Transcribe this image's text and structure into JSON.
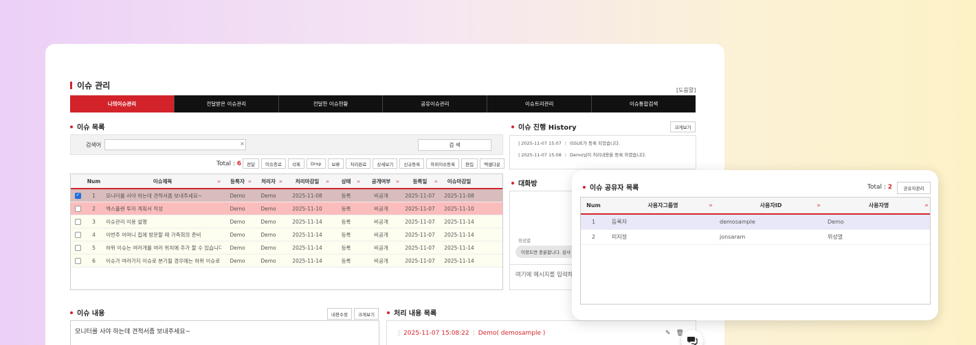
{
  "page": {
    "title": "이슈 관리",
    "help": "[도움말]"
  },
  "tabs": [
    {
      "label": "나의이슈관리",
      "active": true
    },
    {
      "label": "전달받은 이슈관리"
    },
    {
      "label": "전달한 이슈현황"
    },
    {
      "label": "공유이슈관리"
    },
    {
      "label": "이슈트리관리"
    },
    {
      "label": "이슈통합검색"
    }
  ],
  "issue_list": {
    "title": "이슈 목록",
    "search_label": "검색어",
    "search_value": "",
    "search_button": "검 색",
    "total_label": "Total : ",
    "total_count": "6",
    "buttons": [
      "전달",
      "이슈종료",
      "삭제",
      "Drop",
      "보류",
      "처리완료",
      "상세보기",
      "신규등록",
      "하위이슈등록",
      "편집",
      "엑셀다운"
    ],
    "columns": [
      "Num",
      "이슈제목",
      "등록자",
      "처리자",
      "처리마감일",
      "상태",
      "공개여부",
      "등록일",
      "이슈마감일"
    ],
    "rows": [
      {
        "num": "1",
        "title": "모니터를 사야 하는데 견적서좀 보내주세요~",
        "reg": "Demo",
        "proc": "Demo",
        "due": "2025-11-08",
        "state": "등록",
        "pub": "비공개",
        "date": "2025-11-07",
        "end": "2025-11-08",
        "checked": true,
        "style": "sel"
      },
      {
        "num": "2",
        "title": "엑스플랜 투자 계획서 작성",
        "reg": "Demo",
        "proc": "Demo",
        "due": "2025-11-10",
        "state": "등록",
        "pub": "비공개",
        "date": "2025-11-07",
        "end": "2025-11-10",
        "checked": false,
        "style": "pink"
      },
      {
        "num": "3",
        "title": "이슈관리 이용 설명",
        "reg": "Demo",
        "proc": "Demo",
        "due": "2025-11-14",
        "state": "등록",
        "pub": "비공개",
        "date": "2025-11-07",
        "end": "2025-11-14",
        "checked": false,
        "style": "cream"
      },
      {
        "num": "4",
        "title": "이번주 어머니 집에 방문할 때 가족회의 준비",
        "reg": "Demo",
        "proc": "Demo",
        "due": "2025-11-14",
        "state": "등록",
        "pub": "비공개",
        "date": "2025-11-07",
        "end": "2025-11-14",
        "checked": false,
        "style": "cream"
      },
      {
        "num": "5",
        "title": "하위 이슈는 여러개를 여러 위치에 추가 할 수 있습니다.",
        "reg": "Demo",
        "proc": "Demo",
        "due": "2025-11-14",
        "state": "등록",
        "pub": "비공개",
        "date": "2025-11-07",
        "end": "2025-11-14",
        "checked": false,
        "style": "cream"
      },
      {
        "num": "6",
        "title": "이슈가 여러가지 이슈로 분기될 경우에는 하위 이슈로 등록 ...",
        "reg": "Demo",
        "proc": "Demo",
        "due": "2025-11-14",
        "state": "등록",
        "pub": "비공개",
        "date": "2025-11-07",
        "end": "2025-11-14",
        "checked": false,
        "style": "cream"
      }
    ]
  },
  "history": {
    "title": "이슈 진행 History",
    "expand": "크게보기",
    "lines": [
      {
        "time": "2025-11-07 15:07",
        "text": "ISSUE가 등록 되었습니다."
      },
      {
        "time": "2025-11-07 15:08",
        "text": "Demo님이 처리내용을 등록 하였습니다."
      }
    ]
  },
  "chat": {
    "title": "대화방",
    "sender": "위성열",
    "message": "이정도면 충분합니다. 감사",
    "input_placeholder": "여기에 메시지를 입력하"
  },
  "issue_content": {
    "title": "이슈 내용",
    "edit_btn": "내용수정",
    "expand_btn": "크게보기",
    "text": "모니터를 사야 하는데 견적서좀 보내주세요~"
  },
  "process_list": {
    "title": "처리 내용 목록",
    "time": "2025-11-07 15:08:22",
    "user": "Demo( demosample )"
  },
  "share_popup": {
    "title": "이슈 공유자 목록",
    "total_label": "Total : ",
    "total_count": "2",
    "manage_btn": "공유자관리",
    "columns": [
      "Num",
      "사용자그룹명",
      "사용자ID",
      "사용자명"
    ],
    "rows": [
      {
        "num": "1",
        "group": "등록자",
        "id": "demosample",
        "name": "Demo"
      },
      {
        "num": "2",
        "group": "미지정",
        "id": "jonsaram",
        "name": "위성열"
      }
    ]
  },
  "colors": {
    "accent": "#d2232a",
    "dark_tab": "#111111"
  }
}
